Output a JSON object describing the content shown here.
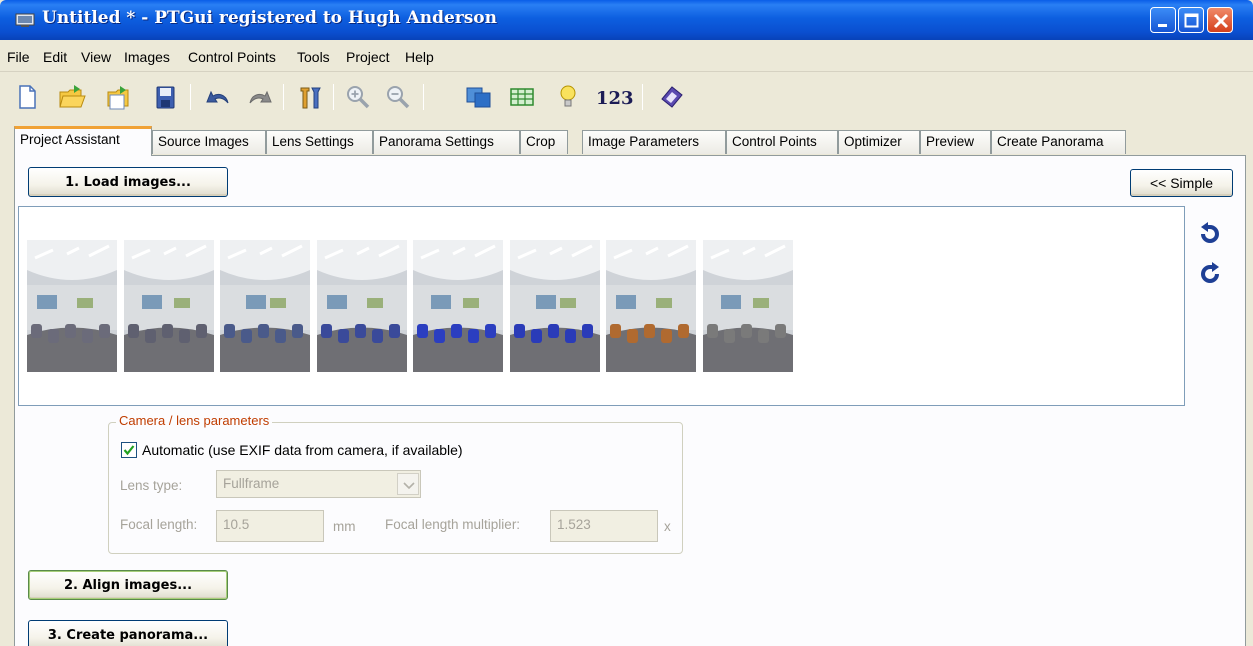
{
  "window": {
    "title": "Untitled * - PTGui registered to Hugh Anderson"
  },
  "menu": [
    "File",
    "Edit",
    "View",
    "Images",
    "Control Points",
    "Tools",
    "Project",
    "Help"
  ],
  "toolbar": {
    "buttons": [
      "new-icon",
      "open-icon",
      "open-recent-icon",
      "save-icon",
      "undo-icon",
      "redo-icon",
      "settings-icon",
      "zoom-in-icon",
      "zoom-out-icon",
      "panorama-editor-icon",
      "table-icon",
      "tips-icon",
      "numbers-icon",
      "help-icon"
    ],
    "numbers_label": "123"
  },
  "tabs": [
    "Project Assistant",
    "Source Images",
    "Lens Settings",
    "Panorama Settings",
    "Crop",
    "Image Parameters",
    "Control Points",
    "Optimizer",
    "Preview",
    "Create Panorama"
  ],
  "active_tab": "Project Assistant",
  "assistant": {
    "load_button": "1. Load images...",
    "simple_button": "<< Simple",
    "align_button": "2. Align images...",
    "create_button": "3. Create panorama...",
    "thumbnail_count": 8
  },
  "camera": {
    "legend": "Camera / lens parameters",
    "automatic_label": "Automatic (use EXIF data from camera, if available)",
    "automatic_checked": true,
    "lens_type_label": "Lens type:",
    "lens_type_value": "Fullframe",
    "focal_length_label": "Focal length:",
    "focal_length_value": "10.5",
    "focal_length_unit": "mm",
    "multiplier_label": "Focal length multiplier:",
    "multiplier_value": "1.523",
    "multiplier_unit": "x"
  },
  "colors": {
    "titlebar": "#0a4fd0",
    "active_tab_accent": "#f0a236",
    "legend": "#c03d00",
    "rotate_icons": "#1e3f95"
  }
}
